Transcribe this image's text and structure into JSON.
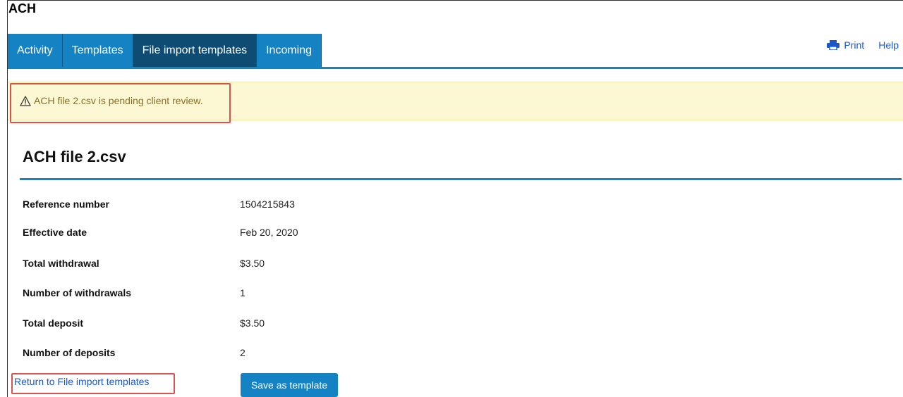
{
  "app": {
    "title": "ACH"
  },
  "tabs": [
    {
      "label": "Activity",
      "active": false
    },
    {
      "label": "Templates",
      "active": false
    },
    {
      "label": "File import templates",
      "active": true
    },
    {
      "label": "Incoming",
      "active": false
    }
  ],
  "top_links": {
    "print_label": "Print",
    "print_icon": "printer-icon",
    "help_label": "Help"
  },
  "alert": {
    "icon": "warning-triangle-icon",
    "message": "ACH file 2.csv is pending client review."
  },
  "document": {
    "title": "ACH file 2.csv",
    "details": [
      {
        "label": "Reference number",
        "value": "1504215843"
      },
      {
        "label": "Effective date",
        "value": "Feb 20, 2020"
      },
      {
        "label": "Total withdrawal",
        "value": "$3.50"
      },
      {
        "label": "Number of withdrawals",
        "value": "1"
      },
      {
        "label": "Total deposit",
        "value": "$3.50"
      },
      {
        "label": "Number of deposits",
        "value": "2"
      }
    ]
  },
  "actions": {
    "return_label": "Return to File import templates",
    "save_label": "Save as template"
  },
  "colors": {
    "accent": "#1582c4",
    "active_tab": "#0e4c73",
    "alert_bg": "#fdf8d4",
    "alert_text": "#8a6d1f",
    "highlight": "#d9534f",
    "link": "#1a57c8"
  }
}
